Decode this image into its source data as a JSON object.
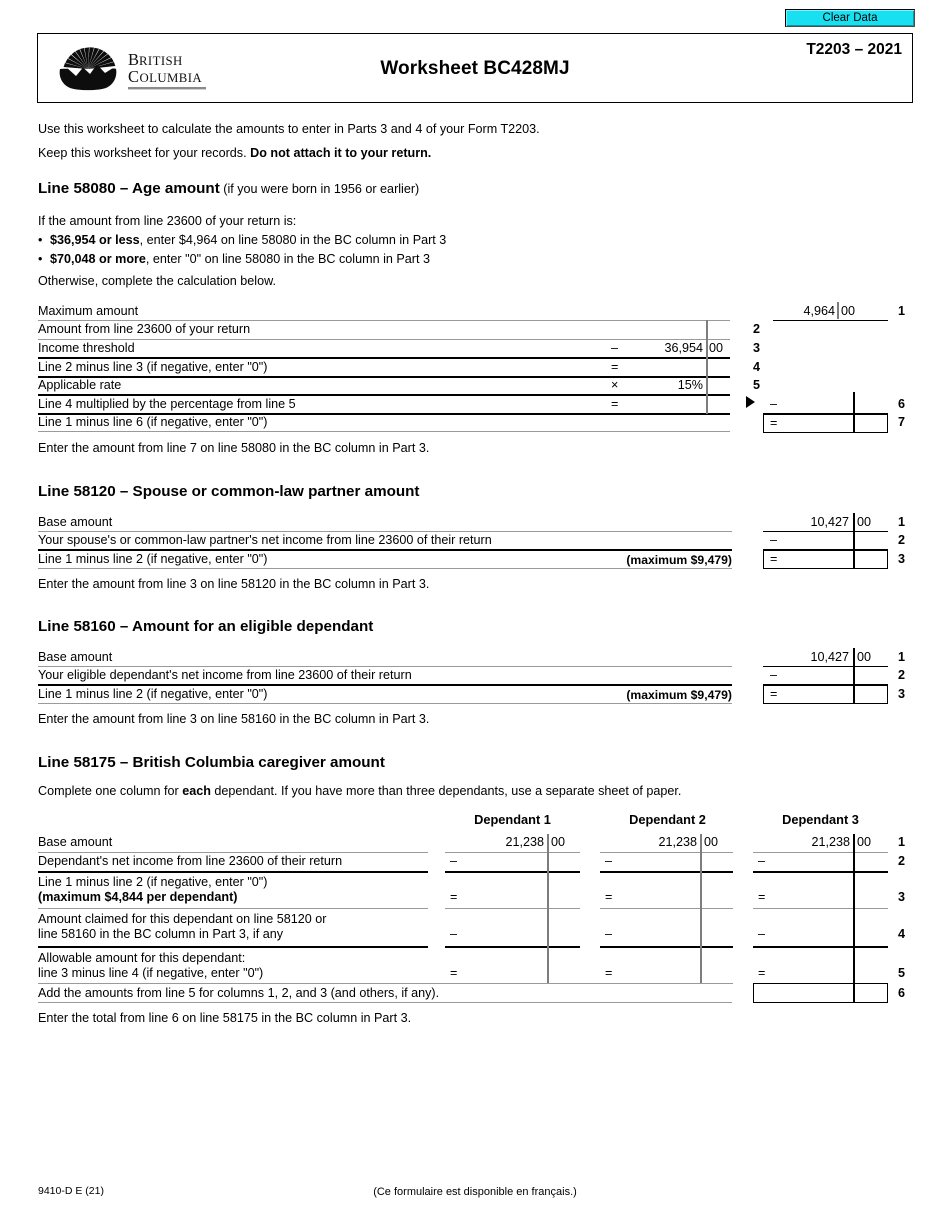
{
  "toolbar": {
    "clear_data_label": "Clear Data"
  },
  "header": {
    "logo_alt": "British Columbia",
    "logo_line1": "BRITISH",
    "logo_line2": "COLUMBIA",
    "title": "Worksheet BC428MJ",
    "form_year": "T2203 – 2021"
  },
  "intro": {
    "line1": "Use this worksheet to calculate the amounts to enter in Parts 3 and 4 of your Form T2203.",
    "line2_prefix": "Keep this worksheet for your records. ",
    "line2_bold": "Do not attach it to your return."
  },
  "sections": [
    {
      "id": "age-amount",
      "heading_main": "Line 58080 – Age amount",
      "heading_sub": " (if you were born in 1956 or earlier)",
      "intro_lines": [
        "If the amount from line 23600 of your return is:"
      ],
      "bullets": [
        {
          "bold": "$36,954 or less",
          "rest": ", enter $4,964 on line 58080 in the BC column in Part 3"
        },
        {
          "bold": "$70,048 or more",
          "rest": ", enter \"0\" on line 58080 in the BC column in Part 3"
        }
      ],
      "after_bullets": "Otherwise, complete the calculation below.",
      "rows": [
        {
          "label": "Maximum amount",
          "lineno": "1",
          "right_amount": "4,964",
          "right_cents": "00"
        },
        {
          "label": "Amount from line 23600 of your return",
          "lineno": "2",
          "mid_op": ""
        },
        {
          "label": "Income threshold",
          "lineno": "3",
          "mid_op": "–",
          "mid_amount": "36,954",
          "mid_cents": "00"
        },
        {
          "label": "Line 2 minus line 3 (if negative, enter \"0\")",
          "lineno": "4",
          "mid_op": "="
        },
        {
          "label": "Applicable rate",
          "lineno": "5",
          "mid_op": "×",
          "mid_amount": "15%"
        },
        {
          "label": "Line 4 multiplied by the percentage from line 5",
          "lineno": "6",
          "mid_op": "=",
          "right_op": "–"
        },
        {
          "label": "Line 1 minus line 6 (if negative, enter \"0\")",
          "lineno": "7",
          "right_op": "="
        }
      ],
      "footer_note": "Enter the amount from line 7 on line 58080 in the BC column in Part 3."
    },
    {
      "id": "spouse-amount",
      "heading_main": "Line 58120 – Spouse or common-law partner amount",
      "heading_sub": "",
      "rows": [
        {
          "label": "Base amount",
          "lineno": "1",
          "right_amount": "10,427",
          "right_cents": "00"
        },
        {
          "label": "Your spouse's or common-law partner's net income from line 23600 of their return",
          "lineno": "2",
          "right_op": "–"
        },
        {
          "label": "Line 1 minus line 2 (if negative, enter \"0\")",
          "lineno": "3",
          "right_op": "=",
          "max_note": "(maximum $9,479)"
        }
      ],
      "footer_note": "Enter the amount from line 3 on line 58120 in the BC column in Part 3."
    },
    {
      "id": "eligible-dependant",
      "heading_main": "Line 58160 – Amount for an eligible dependant",
      "heading_sub": "",
      "rows": [
        {
          "label": "Base amount",
          "lineno": "1",
          "right_amount": "10,427",
          "right_cents": "00"
        },
        {
          "label": "Your eligible dependant's net income from line 23600 of their return",
          "lineno": "2",
          "right_op": "–"
        },
        {
          "label": "Line 1 minus line 2 (if negative, enter \"0\")",
          "lineno": "3",
          "right_op": "=",
          "max_note": "(maximum $9,479)"
        }
      ],
      "footer_note": "Enter the amount from line 3 on line 58160 in the BC column in Part 3."
    },
    {
      "id": "caregiver-amount",
      "heading_main": "Line 58175 – British Columbia caregiver amount",
      "heading_sub": "",
      "instruction_prefix": "Complete one column for ",
      "instruction_bold": "each",
      "instruction_suffix": " dependant. If you have more than three dependants, use a separate sheet of paper.",
      "column_headers": [
        "Dependant 1",
        "Dependant 2",
        "Dependant 3"
      ],
      "rows": [
        {
          "label_line1": "Base amount",
          "label_line2": "",
          "lineno": "1",
          "cols": [
            {
              "amount": "21,238",
              "cents": "00"
            },
            {
              "amount": "21,238",
              "cents": "00"
            },
            {
              "amount": "21,238",
              "cents": "00"
            }
          ]
        },
        {
          "label_line1": "Dependant's net income from line 23600 of their return",
          "label_line2": "",
          "lineno": "2",
          "cols": [
            {
              "op": "–"
            },
            {
              "op": "–"
            },
            {
              "op": "–"
            }
          ]
        },
        {
          "label_line1": "Line 1 minus line 2 (if negative, enter \"0\")",
          "label_line2": "(maximum $4,844 per dependant)",
          "label_line2_bold": true,
          "lineno": "3",
          "cols": [
            {
              "op": "="
            },
            {
              "op": "="
            },
            {
              "op": "="
            }
          ]
        },
        {
          "label_line1": "Amount claimed for this dependant on line 58120 or",
          "label_line2": "line 58160 in the BC column in Part 3, if any",
          "lineno": "4",
          "cols": [
            {
              "op": "–"
            },
            {
              "op": "–"
            },
            {
              "op": "–"
            }
          ]
        },
        {
          "label_line1": "Allowable amount for this dependant:",
          "label_line2": "line 3 minus line 4 (if negative, enter \"0\")",
          "lineno": "5",
          "cols": [
            {
              "op": "="
            },
            {
              "op": "="
            },
            {
              "op": "="
            }
          ]
        }
      ],
      "total_row": {
        "label": "Add the amounts from line 5 for columns 1, 2, and 3 (and others, if any).",
        "lineno": "6"
      },
      "footer_note": "Enter the total from line 6 on line 58175 in the BC column in Part 3."
    }
  ],
  "footer": {
    "form_code": "9410-D E (21)",
    "french_note": "(Ce formulaire est disponible en français.)"
  },
  "colors": {
    "button_fill": "#19e0f0",
    "rule_light": "#808080",
    "rule_dark": "#000000",
    "text": "#000000"
  }
}
